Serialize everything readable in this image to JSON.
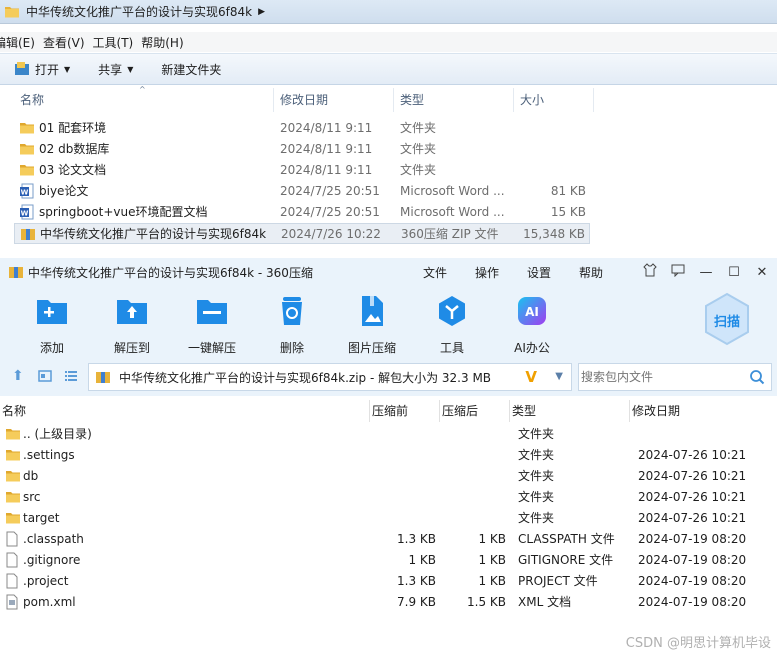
{
  "explorer": {
    "path": "中华传统文化推广平台的设计与实现6f84k",
    "menu": [
      "编辑(E)",
      "查看(V)",
      "工具(T)",
      "帮助(H)"
    ],
    "toolbar": {
      "open": "打开",
      "share": "共享",
      "new_folder": "新建文件夹"
    },
    "headers": {
      "name": "名称",
      "date": "修改日期",
      "type": "类型",
      "size": "大小"
    },
    "rows": [
      {
        "name": "01 配套环境",
        "date": "2024/8/11 9:11",
        "type": "文件夹",
        "size": ""
      },
      {
        "name": "02 db数据库",
        "date": "2024/8/11 9:11",
        "type": "文件夹",
        "size": ""
      },
      {
        "name": "03 论文文档",
        "date": "2024/8/11 9:11",
        "type": "文件夹",
        "size": ""
      },
      {
        "name": "biye论文",
        "date": "2024/7/25 20:51",
        "type": "Microsoft Word ...",
        "size": "81 KB"
      },
      {
        "name": "springboot+vue环境配置文档",
        "date": "2024/7/25 20:51",
        "type": "Microsoft Word ...",
        "size": "15 KB"
      },
      {
        "name": "中华传统文化推广平台的设计与实现6f84k",
        "date": "2024/7/26 10:22",
        "type": "360压缩 ZIP 文件",
        "size": "15,348 KB"
      }
    ]
  },
  "zip": {
    "title": "中华传统文化推广平台的设计与实现6f84k - 360压缩",
    "menus": [
      "文件",
      "操作",
      "设置",
      "帮助"
    ],
    "tools": [
      "添加",
      "解压到",
      "一键解压",
      "删除",
      "图片压缩",
      "工具",
      "AI办公"
    ],
    "scan_label": "扫描",
    "path": "中华传统文化推广平台的设计与实现6f84k.zip - 解包大小为 32.3 MB",
    "search_placeholder": "搜索包内文件",
    "headers": {
      "name": "名称",
      "before": "压缩前",
      "after": "压缩后",
      "type": "类型",
      "date": "修改日期"
    },
    "rows": [
      {
        "name": ".. (上级目录)",
        "before": "",
        "after": "",
        "type": "文件夹",
        "date": "",
        "kind": "folder"
      },
      {
        "name": ".settings",
        "before": "",
        "after": "",
        "type": "文件夹",
        "date": "2024-07-26 10:21",
        "kind": "folder"
      },
      {
        "name": "db",
        "before": "",
        "after": "",
        "type": "文件夹",
        "date": "2024-07-26 10:21",
        "kind": "folder"
      },
      {
        "name": "src",
        "before": "",
        "after": "",
        "type": "文件夹",
        "date": "2024-07-26 10:21",
        "kind": "folder"
      },
      {
        "name": "target",
        "before": "",
        "after": "",
        "type": "文件夹",
        "date": "2024-07-26 10:21",
        "kind": "folder"
      },
      {
        "name": ".classpath",
        "before": "1.3 KB",
        "after": "1 KB",
        "type": "CLASSPATH 文件",
        "date": "2024-07-19 08:20",
        "kind": "file"
      },
      {
        "name": ".gitignore",
        "before": "1 KB",
        "after": "1 KB",
        "type": "GITIGNORE 文件",
        "date": "2024-07-19 08:20",
        "kind": "file"
      },
      {
        "name": ".project",
        "before": "1.3 KB",
        "after": "1 KB",
        "type": "PROJECT 文件",
        "date": "2024-07-19 08:20",
        "kind": "file"
      },
      {
        "name": "pom.xml",
        "before": "7.9 KB",
        "after": "1.5 KB",
        "type": "XML 文档",
        "date": "2024-07-19 08:20",
        "kind": "xml"
      }
    ]
  },
  "watermark": "CSDN @明思计算机毕设"
}
